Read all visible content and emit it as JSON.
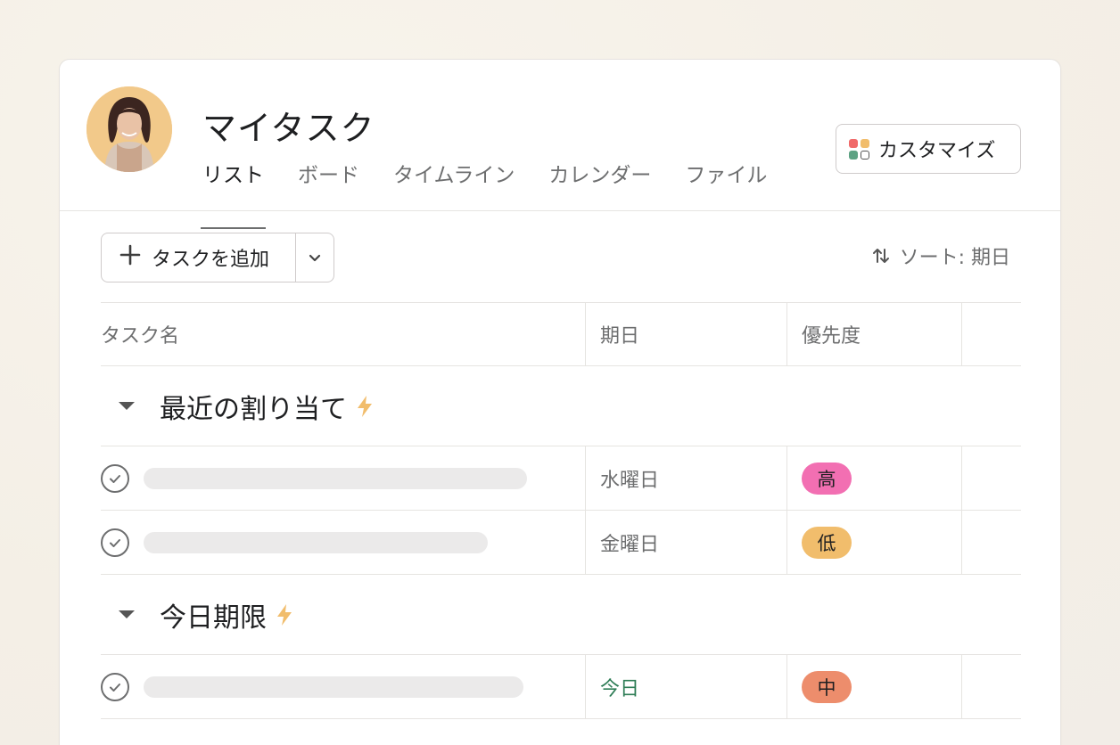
{
  "header": {
    "title": "マイタスク",
    "tabs": [
      {
        "label": "リスト",
        "active": true
      },
      {
        "label": "ボード",
        "active": false
      },
      {
        "label": "タイムライン",
        "active": false
      },
      {
        "label": "カレンダー",
        "active": false
      },
      {
        "label": "ファイル",
        "active": false
      }
    ],
    "customize_label": "カスタマイズ",
    "customize_icon_colors": [
      "#f06a6a",
      "#f1bd6c",
      "#5da283",
      "#ffffff"
    ]
  },
  "toolbar": {
    "add_task_label": "タスクを追加",
    "sort_label": "ソート: 期日"
  },
  "table": {
    "columns": [
      "タスク名",
      "期日",
      "優先度"
    ],
    "sections": [
      {
        "title": "最近の割り当て",
        "rows": [
          {
            "due": "水曜日",
            "due_today": false,
            "priority": "高",
            "priority_color": "#f26fb2"
          },
          {
            "due": "金曜日",
            "due_today": false,
            "priority": "低",
            "priority_color": "#f1bd6c"
          }
        ]
      },
      {
        "title": "今日期限",
        "rows": [
          {
            "due": "今日",
            "due_today": true,
            "priority": "中",
            "priority_color": "#ed8d6c"
          }
        ]
      }
    ]
  },
  "colors": {
    "accent_today": "#2e7d56",
    "bolt": "#f1bd6c",
    "placeholder_bar": "#ebeaea"
  }
}
